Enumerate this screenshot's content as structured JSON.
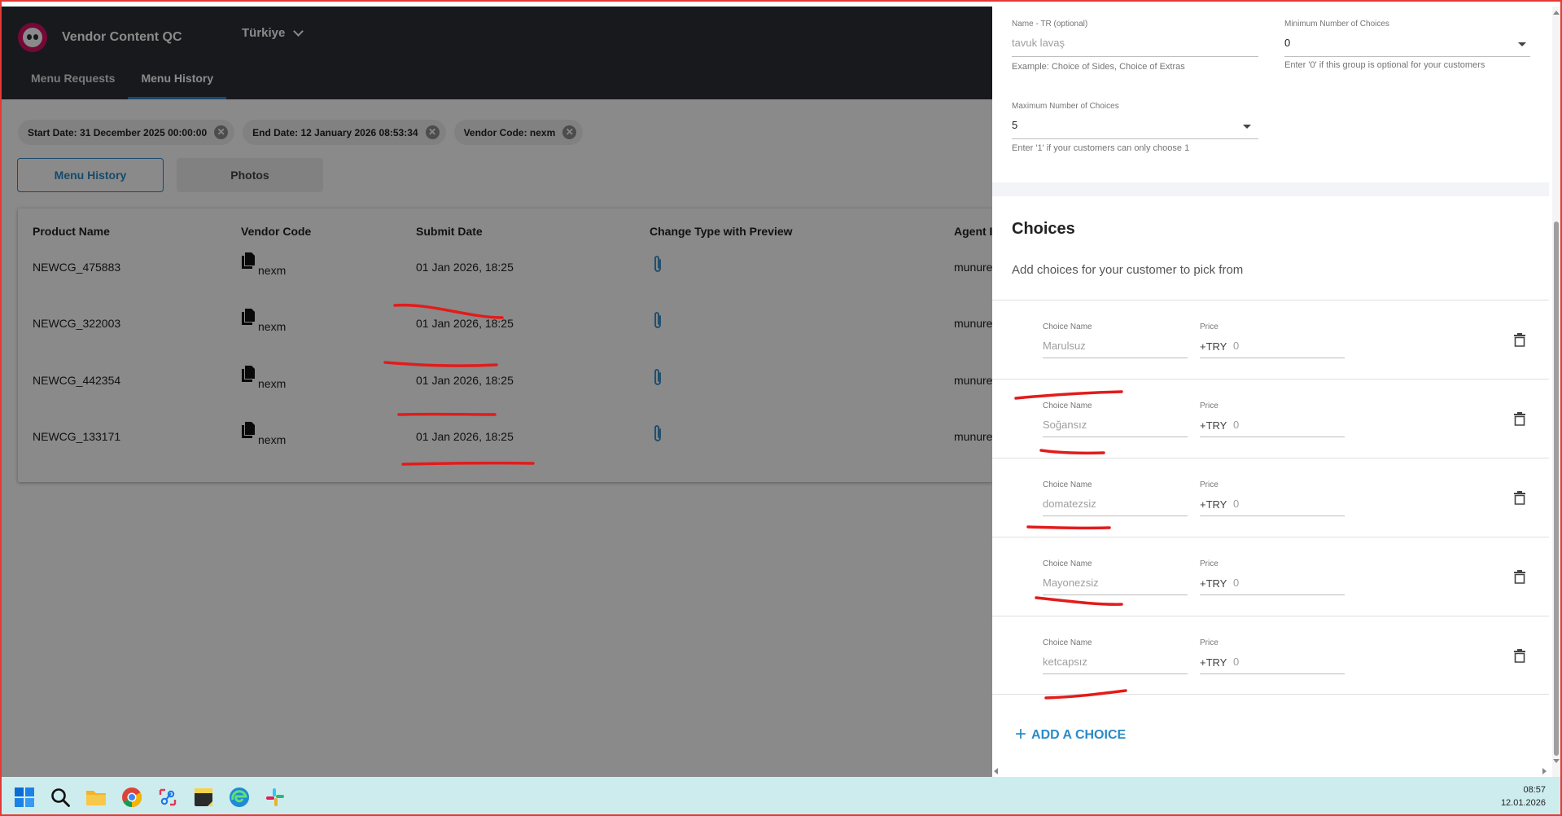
{
  "app": {
    "title": "Vendor Content QC",
    "country": "Türkiye"
  },
  "nav": {
    "tabs": [
      {
        "label": "Menu Requests"
      },
      {
        "label": "Menu History"
      }
    ]
  },
  "filters": [
    {
      "label": "Start Date: 31 December 2025 00:00:00"
    },
    {
      "label": "End Date: 12 January 2026 08:53:34"
    },
    {
      "label": "Vendor Code: nexm"
    }
  ],
  "toggle": {
    "history": "Menu History",
    "photos": "Photos"
  },
  "table": {
    "headers": {
      "product": "Product Name",
      "vendor": "Vendor Code",
      "submit": "Submit Date",
      "change": "Change Type with Preview",
      "agent": "Agent In"
    },
    "rows": [
      {
        "product": "NEWCG_475883",
        "vendor": "nexm",
        "date": "01 Jan 2026, 18:25",
        "agent": "munure"
      },
      {
        "product": "NEWCG_322003",
        "vendor": "nexm",
        "date": "01 Jan 2026, 18:25",
        "agent": "munure"
      },
      {
        "product": "NEWCG_442354",
        "vendor": "nexm",
        "date": "01 Jan 2026, 18:25",
        "agent": "munure"
      },
      {
        "product": "NEWCG_133171",
        "vendor": "nexm",
        "date": "01 Jan 2026, 18:25",
        "agent": "munure"
      }
    ]
  },
  "panel": {
    "name_tr": {
      "label": "Name - TR (optional)",
      "value": "tavuk lavaş",
      "helper": "Example: Choice of Sides, Choice of Extras"
    },
    "min_choices": {
      "label": "Minimum Number of Choices",
      "value": "0",
      "helper": "Enter '0' if this group is optional for your customers"
    },
    "max_choices": {
      "label": "Maximum Number of Choices",
      "value": "5",
      "helper": "Enter '1' if your customers can only choose 1"
    },
    "choices_title": "Choices",
    "choices_subtitle": "Add choices for your customer to pick from",
    "choice_name_label": "Choice Name",
    "price_label": "Price",
    "currency": "+TRY",
    "choices": [
      {
        "name": "Marulsuz",
        "price": "0"
      },
      {
        "name": "Soğansız",
        "price": "0"
      },
      {
        "name": "domatezsiz",
        "price": "0"
      },
      {
        "name": "Mayonezsiz",
        "price": "0"
      },
      {
        "name": "ketcapsız",
        "price": "0"
      }
    ],
    "add_choice": "ADD A CHOICE",
    "add_plus": "+"
  },
  "taskbar": {
    "icons": [
      "windows-start-icon",
      "search-icon",
      "file-explorer-icon",
      "chrome-icon",
      "snipping-tool-icon",
      "sticky-notes-icon",
      "edge-icon",
      "slack-icon"
    ],
    "time": "08:57",
    "date": "12.01.2026"
  },
  "colors": {
    "header": "#2d2f36",
    "accent": "#2b8ac6",
    "brand": "#d70f64",
    "annotation": "#e31b1b",
    "taskbar": "#cdecee"
  }
}
